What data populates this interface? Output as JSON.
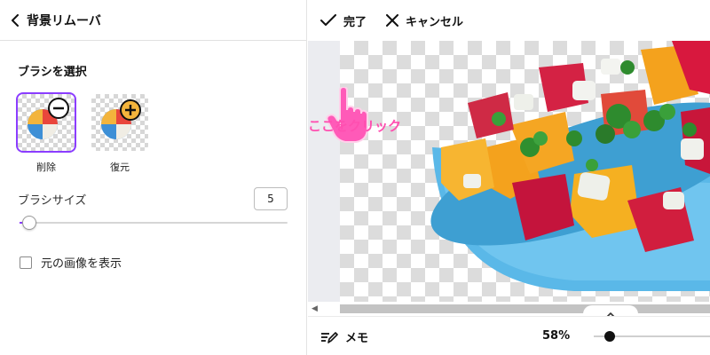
{
  "left_panel": {
    "back_title": "背景リムーバ",
    "brush_section_title": "ブラシを選択",
    "brushes": [
      {
        "label": "削除",
        "icon": "minus-circle-icon",
        "selected": true
      },
      {
        "label": "復元",
        "icon": "plus-circle-icon",
        "selected": false
      }
    ],
    "brush_size_label": "ブラシサイズ",
    "brush_size_value": "5",
    "show_original_label": "元の画像を表示",
    "show_original_checked": false
  },
  "toolbar": {
    "done_label": "完了",
    "cancel_label": "キャンセル"
  },
  "annotation": {
    "text": "ここをクリック",
    "color": "#ff4fb0"
  },
  "bottom_bar": {
    "memo_label": "メモ",
    "zoom_label": "58%"
  },
  "colors": {
    "accent": "#8b3dff",
    "annotation": "#ff4fb0",
    "bowl": "#5ab8e8"
  }
}
